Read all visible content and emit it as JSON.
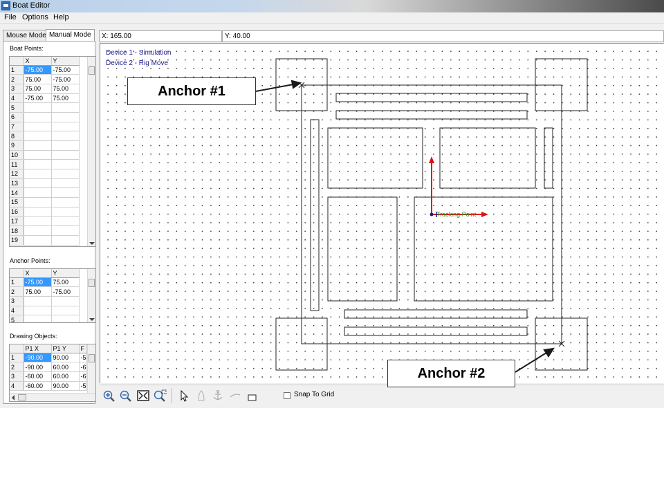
{
  "window": {
    "title": "Boat Editor"
  },
  "menubar": {
    "items": [
      "File",
      "Options",
      "Help"
    ]
  },
  "tabs": [
    "Mouse Mode",
    "Manual Mode"
  ],
  "boat_points": {
    "label": "Boat Points:",
    "columns": [
      "X",
      "Y"
    ],
    "rows": [
      [
        "1",
        "-75.00",
        "-75.00"
      ],
      [
        "2",
        "75.00",
        "-75.00"
      ],
      [
        "3",
        "75.00",
        "75.00"
      ],
      [
        "4",
        "-75.00",
        "75.00"
      ],
      [
        "5",
        "",
        ""
      ],
      [
        "6",
        "",
        ""
      ],
      [
        "7",
        "",
        ""
      ],
      [
        "8",
        "",
        ""
      ],
      [
        "9",
        "",
        ""
      ],
      [
        "10",
        "",
        ""
      ],
      [
        "11",
        "",
        ""
      ],
      [
        "12",
        "",
        ""
      ],
      [
        "13",
        "",
        ""
      ],
      [
        "14",
        "",
        ""
      ],
      [
        "15",
        "",
        ""
      ],
      [
        "16",
        "",
        ""
      ],
      [
        "17",
        "",
        ""
      ],
      [
        "18",
        "",
        ""
      ],
      [
        "19",
        "",
        ""
      ]
    ]
  },
  "anchor_points": {
    "label": "Anchor Points:",
    "columns": [
      "X",
      "Y"
    ],
    "rows": [
      [
        "1",
        "-75.00",
        "75.00"
      ],
      [
        "2",
        "75.00",
        "-75.00"
      ],
      [
        "3",
        "",
        ""
      ],
      [
        "4",
        "",
        ""
      ],
      [
        "5",
        "",
        ""
      ]
    ]
  },
  "drawing_objects": {
    "label": "Drawing Objects:",
    "columns": [
      "P1 X",
      "P1 Y",
      "F"
    ],
    "rows": [
      [
        "1",
        "-90.00",
        "90.00",
        "-5"
      ],
      [
        "2",
        "-90.00",
        "60.00",
        "-6"
      ],
      [
        "3",
        "-60.00",
        "60.00",
        "-6"
      ],
      [
        "4",
        "-60.00",
        "90.00",
        "-5"
      ]
    ]
  },
  "coords": {
    "x": "X: 165.00",
    "y": "Y: 40.00"
  },
  "canvas": {
    "device_labels": [
      "Device 1 - Simulation",
      "Device 2 - Rig Move"
    ],
    "tracking_label": "Tracking Point"
  },
  "toolbar": {
    "tools": [
      "zoom-in-icon",
      "zoom-out-icon",
      "zoom-fit-icon",
      "zoom-window-icon",
      "pointer-icon",
      "boat-icon",
      "anchor-icon",
      "line-icon",
      "rectangle-icon"
    ],
    "snap_label": "Snap To Grid",
    "snap_checked": false
  },
  "callouts": {
    "anchor1": "Anchor #1",
    "anchor2": "Anchor #2"
  },
  "colors": {
    "selection": "#3399ff",
    "axis": "#dd1111",
    "tracking": "#2a9a2a",
    "device_text": "#1a1a8c"
  }
}
